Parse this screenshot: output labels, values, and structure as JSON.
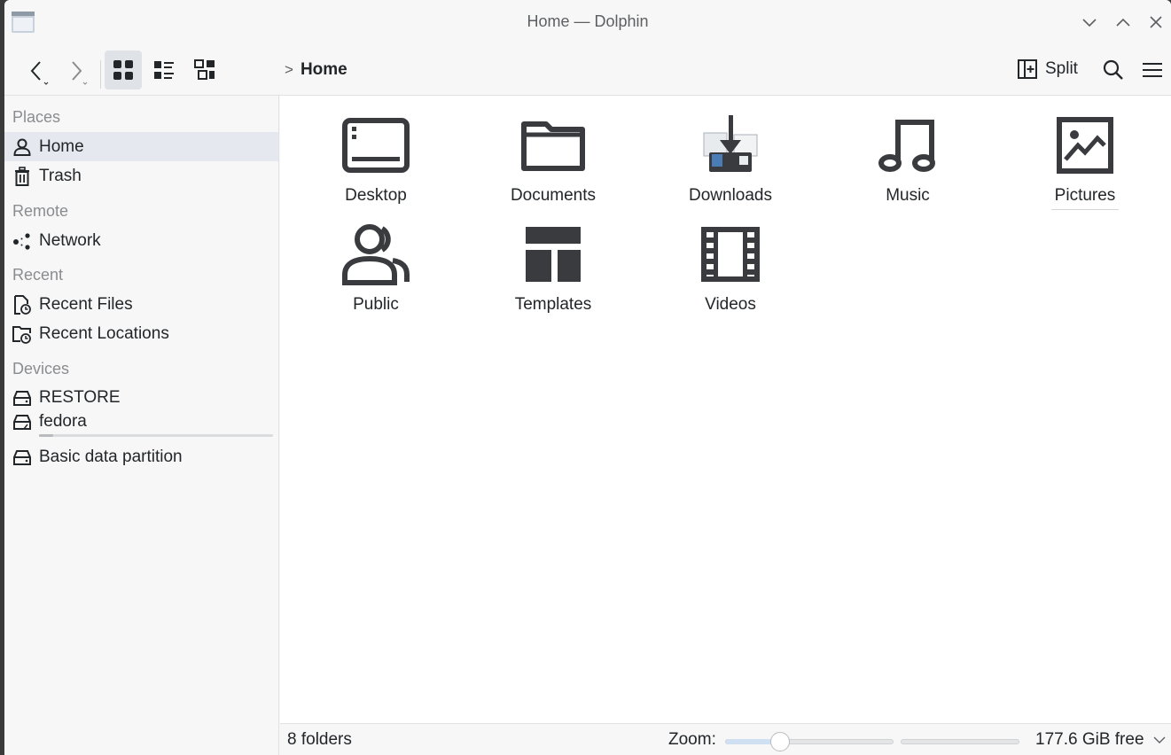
{
  "window": {
    "title": "Home — Dolphin"
  },
  "toolbar": {
    "back_icon": "back-arrow-icon",
    "forward_icon": "forward-arrow-icon",
    "view_modes": [
      "icons-view",
      "details-view",
      "compact-view"
    ],
    "active_view": "icons-view",
    "breadcrumb": {
      "separator": ">",
      "current": "Home"
    },
    "split_label": "Split",
    "search_icon": "search-icon",
    "menu_icon": "hamburger-menu-icon"
  },
  "sidebar": {
    "sections": {
      "places": "Places",
      "remote": "Remote",
      "recent": "Recent",
      "devices": "Devices"
    },
    "places": [
      {
        "label": "Home",
        "icon": "user-icon",
        "active": true
      },
      {
        "label": "Trash",
        "icon": "trash-icon"
      }
    ],
    "remote": [
      {
        "label": "Network",
        "icon": "network-icon"
      }
    ],
    "recent": [
      {
        "label": "Recent Files",
        "icon": "recent-files-icon"
      },
      {
        "label": "Recent Locations",
        "icon": "recent-locations-icon"
      }
    ],
    "devices": [
      {
        "label": "RESTORE",
        "icon": "drive-icon"
      },
      {
        "label": "fedora",
        "icon": "drive-icon",
        "capacity_used_fraction": 0.06
      },
      {
        "label": "Basic data partition",
        "icon": "drive-icon"
      }
    ]
  },
  "main": {
    "items": [
      {
        "label": "Desktop",
        "icon": "desktop-folder-icon"
      },
      {
        "label": "Documents",
        "icon": "folder-icon"
      },
      {
        "label": "Downloads",
        "icon": "downloads-folder-icon"
      },
      {
        "label": "Music",
        "icon": "music-note-icon"
      },
      {
        "label": "Pictures",
        "icon": "pictures-icon"
      },
      {
        "label": "Public",
        "icon": "public-users-icon"
      },
      {
        "label": "Templates",
        "icon": "templates-icon"
      },
      {
        "label": "Videos",
        "icon": "film-icon"
      }
    ]
  },
  "statusbar": {
    "summary": "8 folders",
    "zoom_label": "Zoom:",
    "zoom_level_fraction": 0.3,
    "free_space": "177.6 GiB free"
  },
  "colors": {
    "window_bg": "#f7f7f7",
    "content_bg": "#ffffff",
    "active_row": "#e5e9ef",
    "icon_dark": "#3a3b3f",
    "text": "#232629",
    "muted_text": "#8a8c8f"
  }
}
